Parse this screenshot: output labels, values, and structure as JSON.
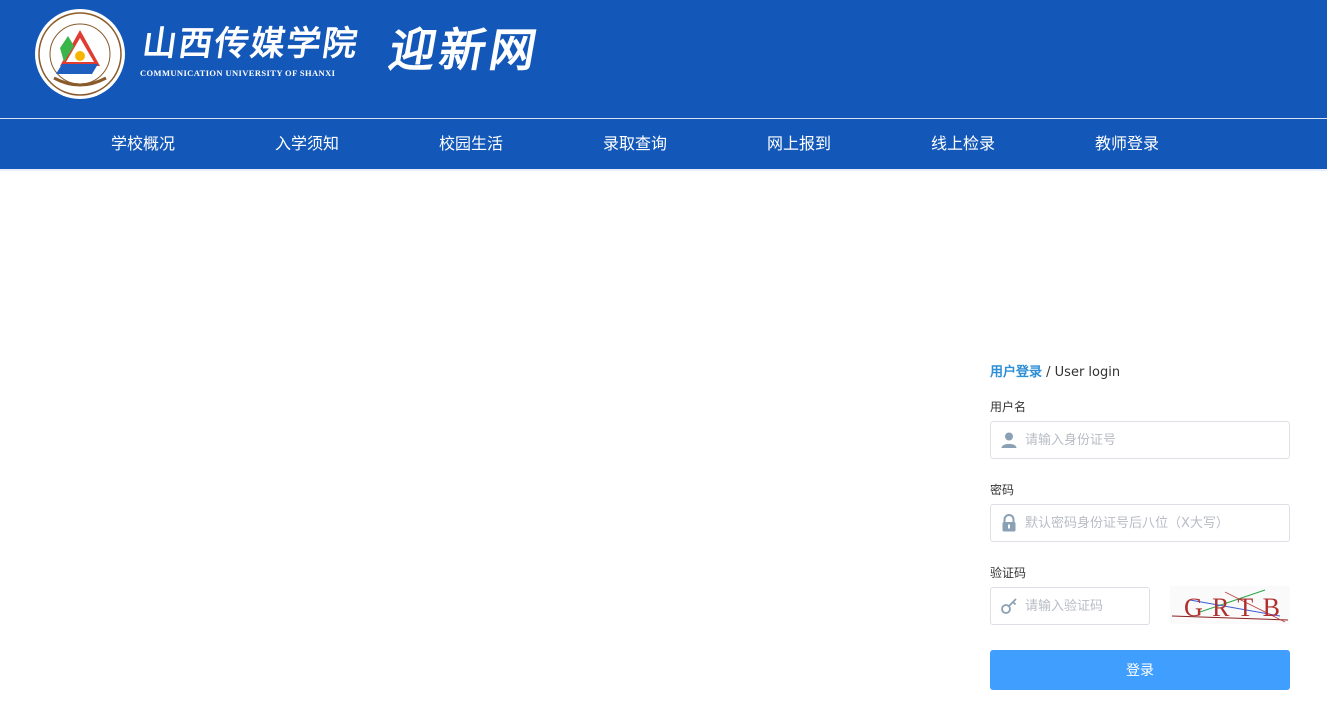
{
  "header": {
    "brand_cn": "山西传媒学院",
    "brand_en": "COMMUNICATION UNIVERSITY OF SHANXI",
    "site_name": "迎新网",
    "background": "#1358b8"
  },
  "nav": {
    "items": [
      {
        "label": "学校概况"
      },
      {
        "label": "入学须知"
      },
      {
        "label": "校园生活"
      },
      {
        "label": "录取查询"
      },
      {
        "label": "网上报到"
      },
      {
        "label": "线上检录"
      },
      {
        "label": "教师登录"
      }
    ]
  },
  "login": {
    "title_cn": "用户登录",
    "separator": " / ",
    "title_en": "User login",
    "username": {
      "label": "用户名",
      "placeholder": "请输入身份证号",
      "value": "",
      "icon": "user-icon"
    },
    "password": {
      "label": "密码",
      "placeholder": "默认密码身份证号后八位（X大写）",
      "value": "",
      "icon": "lock-icon"
    },
    "captcha": {
      "label": "验证码",
      "placeholder": "请输入验证码",
      "value": "",
      "icon": "key-icon",
      "image_text": "GRTB"
    },
    "submit_label": "登录",
    "accent_color": "#2e8fd6",
    "button_color": "#409eff"
  }
}
